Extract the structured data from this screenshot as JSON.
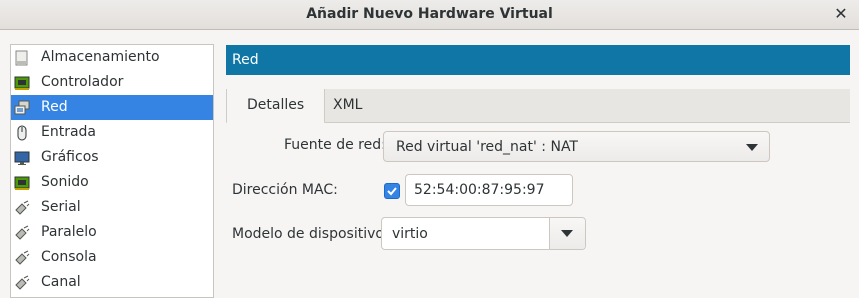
{
  "window": {
    "title": "Añadir Nuevo Hardware Virtual",
    "close_glyph": "✕"
  },
  "sidebar": {
    "selected_index": 2,
    "items": [
      {
        "label": "Almacenamiento",
        "icon": "disk-icon"
      },
      {
        "label": "Controlador",
        "icon": "chip-icon"
      },
      {
        "label": "Red",
        "icon": "network-icon"
      },
      {
        "label": "Entrada",
        "icon": "mouse-icon"
      },
      {
        "label": "Gráficos",
        "icon": "monitor-icon"
      },
      {
        "label": "Sonido",
        "icon": "chip-icon"
      },
      {
        "label": "Serial",
        "icon": "plug-icon"
      },
      {
        "label": "Paralelo",
        "icon": "plug-icon"
      },
      {
        "label": "Consola",
        "icon": "plug-icon"
      },
      {
        "label": "Canal",
        "icon": "plug-icon"
      }
    ]
  },
  "main": {
    "header": "Red",
    "tabs": [
      {
        "label": "Detalles",
        "active": true
      },
      {
        "label": "XML",
        "active": false
      }
    ],
    "form": {
      "network_source_label": "Fuente de red:",
      "network_source_value": "Red virtual 'red_nat' : NAT",
      "mac_label": "Dirección MAC:",
      "mac_checked": true,
      "mac_value": "52:54:00:87:95:97",
      "device_model_label": "Modelo de dispositivo:",
      "device_model_value": "virtio"
    }
  },
  "colors": {
    "accent": "#3584e4",
    "header_bar": "#0f76a6"
  }
}
